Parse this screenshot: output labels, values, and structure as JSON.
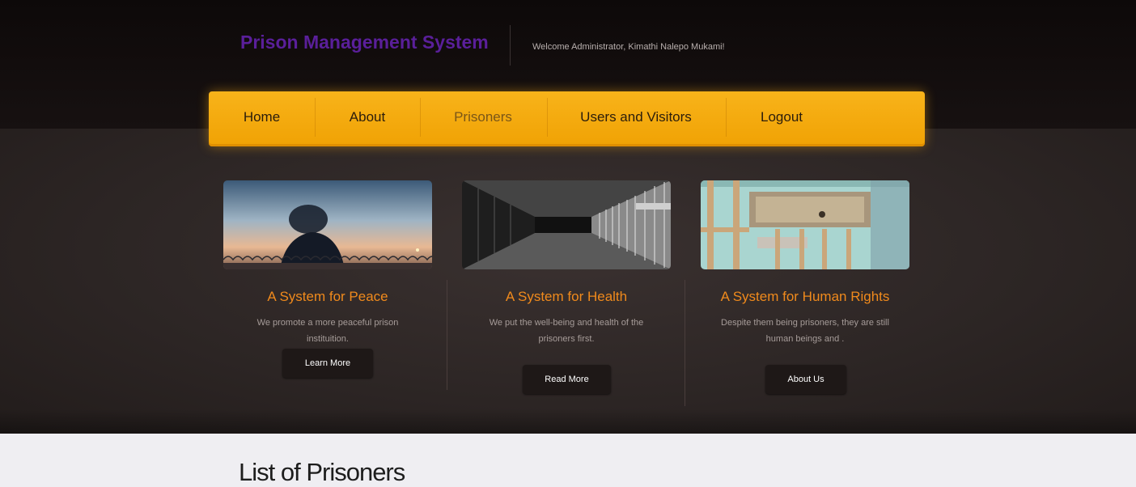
{
  "header": {
    "title": "Prison Management System",
    "welcome": "Welcome Administrator, Kimathi Nalepo Mukami!"
  },
  "nav": {
    "items": [
      {
        "label": "Home"
      },
      {
        "label": "About"
      },
      {
        "label": "Prisoners"
      },
      {
        "label": "Users and Visitors"
      },
      {
        "label": "Logout"
      }
    ],
    "active": "Prisoners"
  },
  "features": [
    {
      "image": "silhouette-at-dusk-photo",
      "title": "A System for Peace",
      "description": "We promote a more peaceful prison instituition.",
      "button": "Learn More"
    },
    {
      "image": "prison-corridor-photo",
      "title": "A System for Health",
      "description": "We put the well-being and health of the prisoners first.",
      "button": "Read More"
    },
    {
      "image": "cell-bunk-bed-photo",
      "title": "A System for Human Rights",
      "description": "Despite them being prisoners, they are still human beings and .",
      "button": "About Us"
    }
  ],
  "section": {
    "title": "List of Prisoners"
  },
  "colors": {
    "accent": "#f0a204",
    "title": "#5a1f9a",
    "feature_title": "#f08a1c"
  }
}
